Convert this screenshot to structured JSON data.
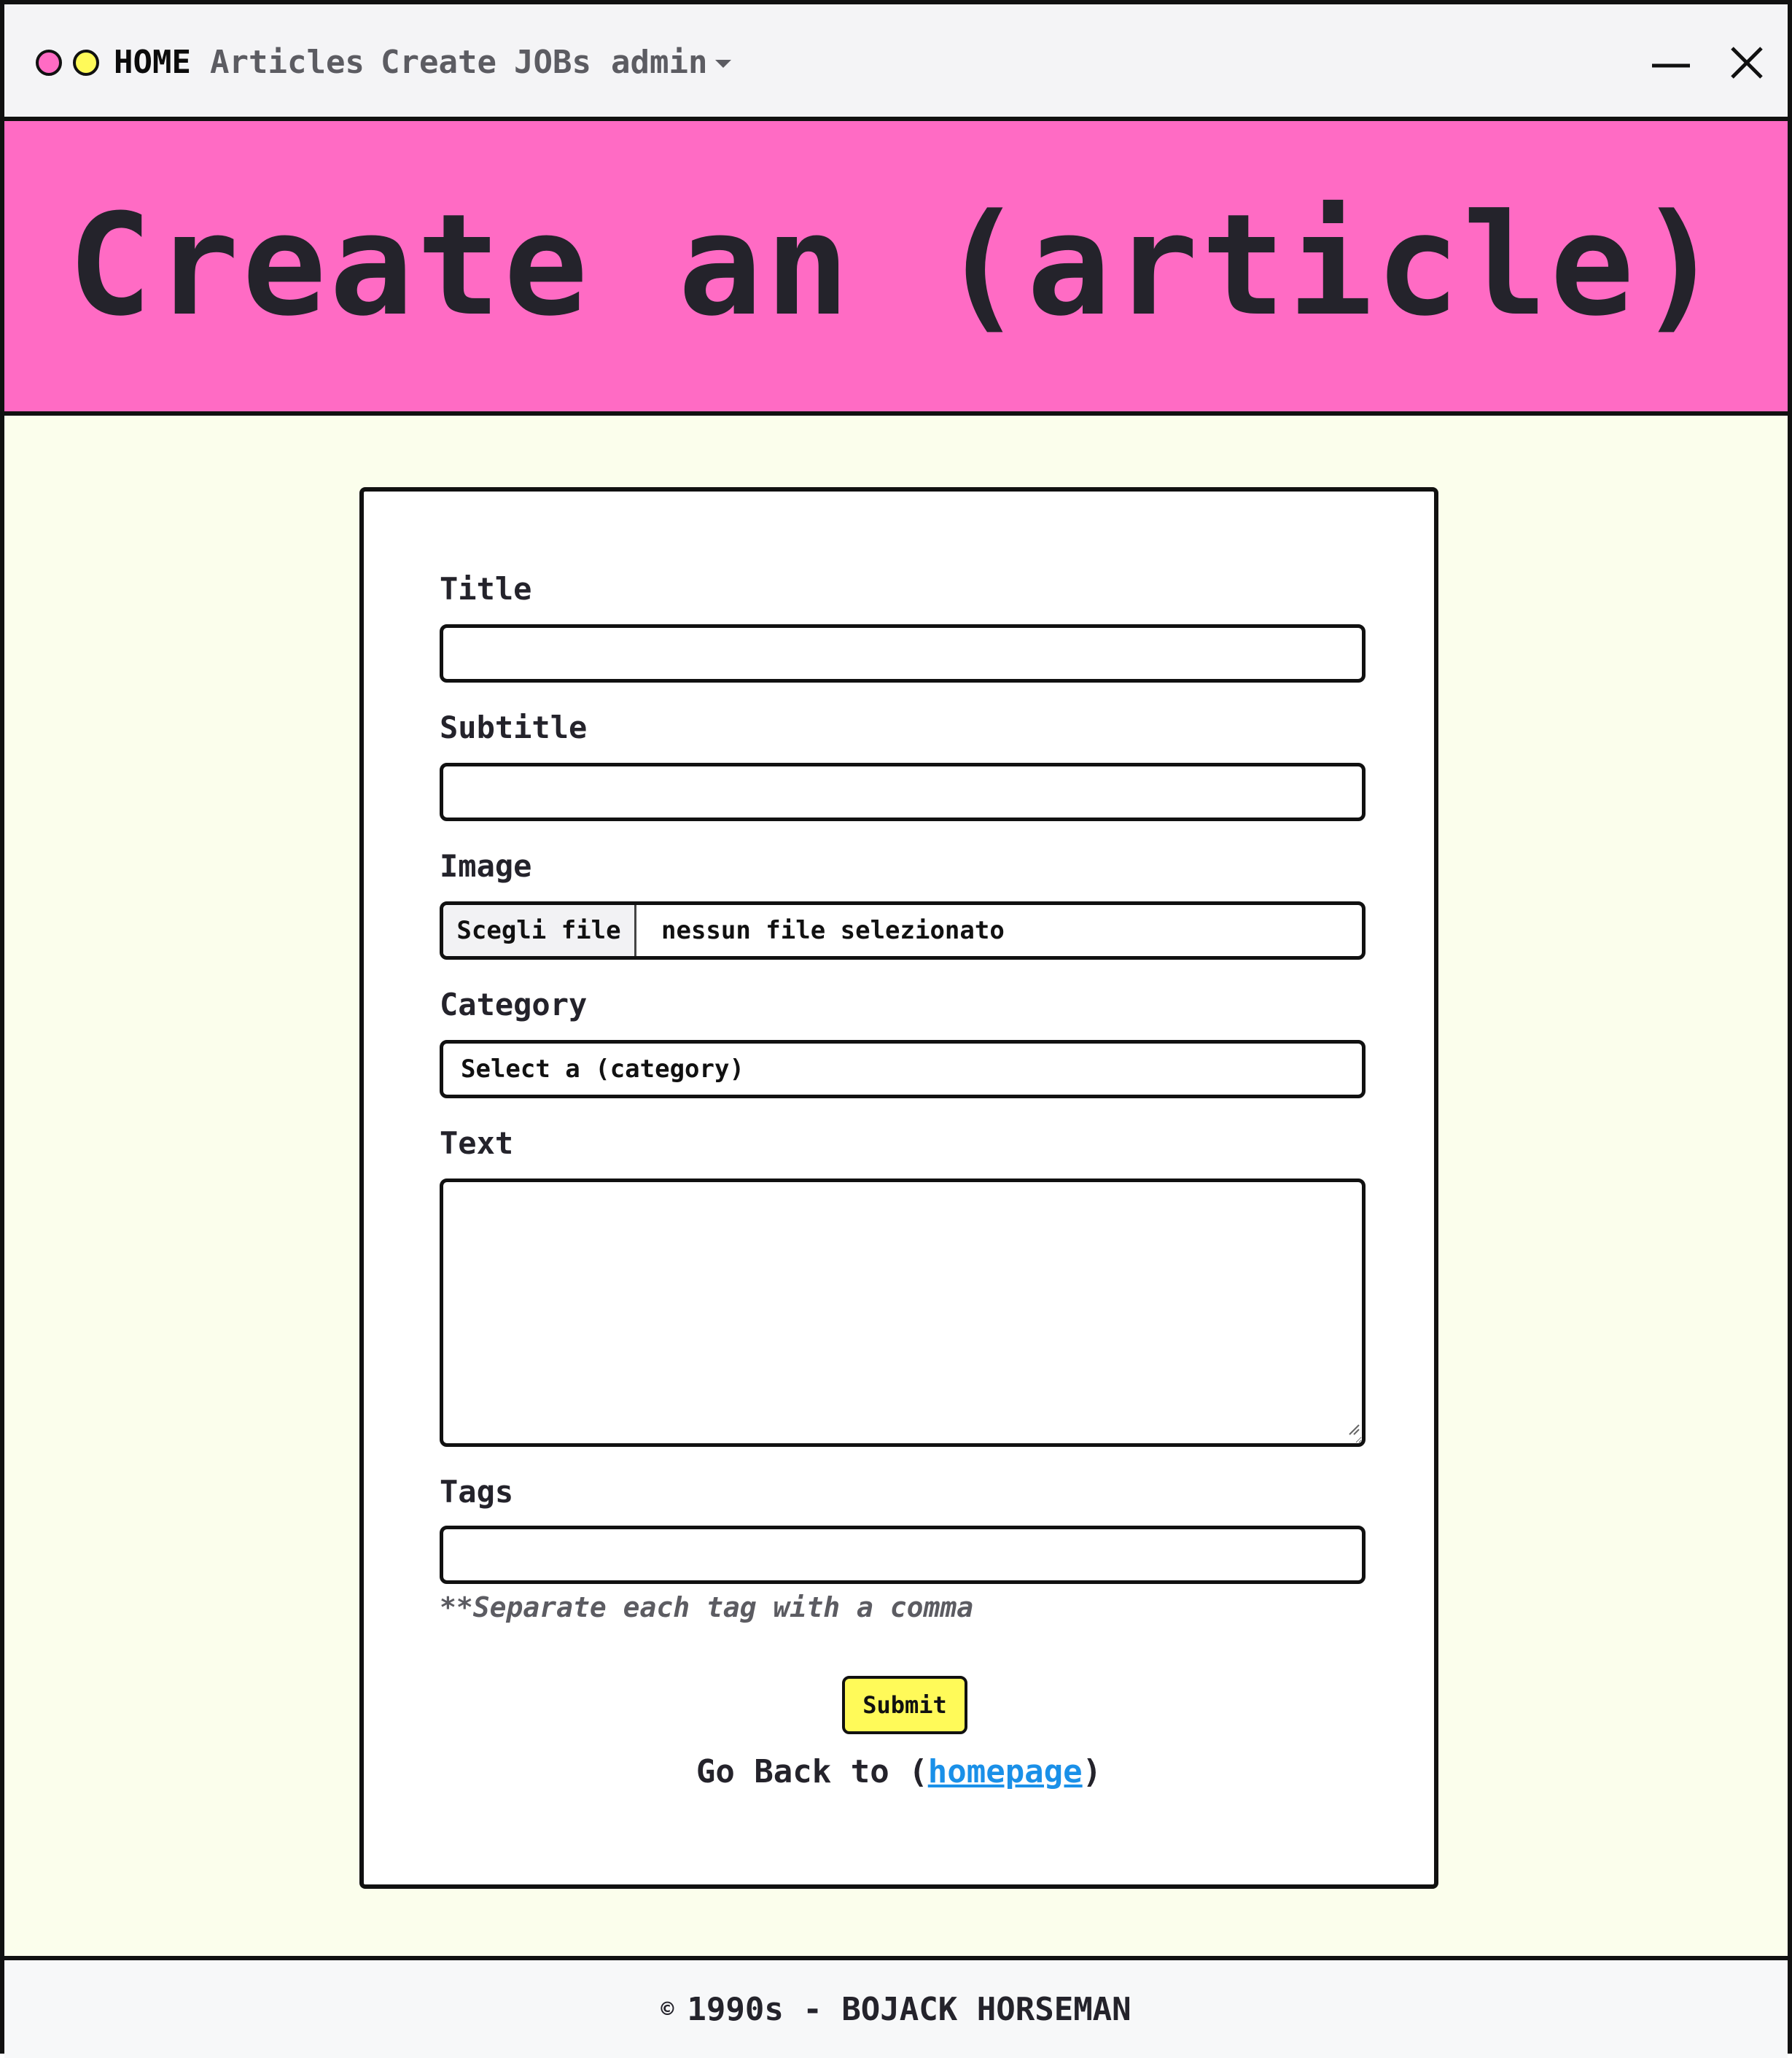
{
  "nav": {
    "home": "HOME",
    "articles": "Articles",
    "create": "Create",
    "jobs": "JOBs",
    "admin": "admin"
  },
  "hero": {
    "title": "Create an (article)"
  },
  "form": {
    "title_label": "Title",
    "title_value": "",
    "subtitle_label": "Subtitle",
    "subtitle_value": "",
    "image_label": "Image",
    "file_button": "Scegli file",
    "file_status": "nessun file selezionato",
    "category_label": "Category",
    "category_selected": "Select a (category)",
    "text_label": "Text",
    "text_value": "",
    "tags_label": "Tags",
    "tags_value": "",
    "tags_hint": "**Separate each tag with a comma",
    "submit": "Submit",
    "goback_prefix": "Go Back to (",
    "goback_link": "homepage",
    "goback_suffix": ")"
  },
  "footer": {
    "copyright_symbol": "©",
    "text": "1990s - BOJACK HORSEMAN"
  },
  "colors": {
    "hero_bg": "#ff6bc4",
    "page_bg": "#fbfeec",
    "accent_yellow": "#fffa59",
    "link": "#1a90e8"
  }
}
